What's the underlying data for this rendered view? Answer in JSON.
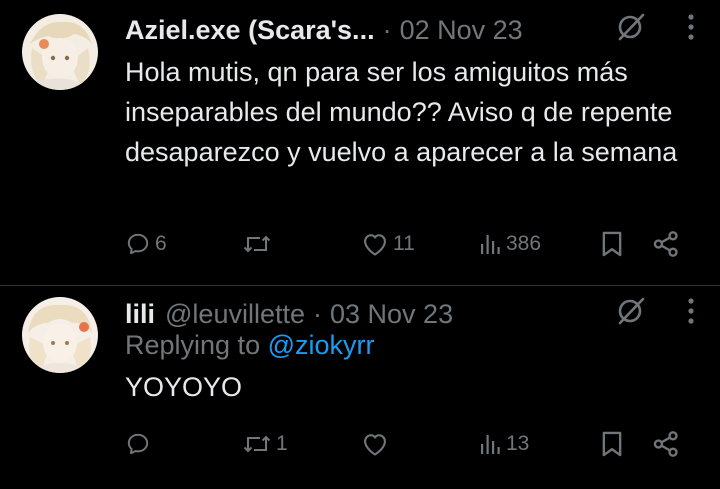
{
  "tweets": [
    {
      "author_name": "Aziel.exe (Scara's...",
      "dot": "·",
      "date": "02 Nov 23",
      "text": "Hola mutis, qn para ser los amiguitos más inseparables del mundo?? Aviso q de repente desaparezco y vuelvo a aparecer a la semana",
      "stats": {
        "replies": "6",
        "retweets": "",
        "likes": "11",
        "views": "386"
      }
    },
    {
      "author_name": "lili",
      "handle": "@leuvillette",
      "dot": "·",
      "date": "03 Nov 23",
      "replying_prefix": "Replying to ",
      "replying_to": "@ziokyrr",
      "text": "YOYOYO",
      "stats": {
        "replies": "",
        "retweets": "1",
        "likes": "",
        "views": "13"
      }
    }
  ],
  "colors": {
    "background": "#000000",
    "text": "#e7e9ea",
    "muted": "#71767b",
    "link": "#1d9bf0"
  }
}
